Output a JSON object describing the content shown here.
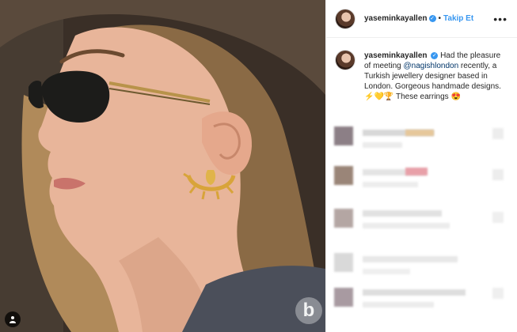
{
  "post": {
    "username": "yaseminkayallen",
    "follow_label": "Takip Et",
    "more_label": "•••",
    "caption_prefix": "Had the pleasure of meeting ",
    "caption_mention": "@nagishlondon",
    "caption_suffix": " recently, a Turkish jewellery designer based in London. Gorgeous handmade designs.",
    "caption_emojis": "⚡💛🏆",
    "caption_end": "These earrings 😍"
  },
  "watermark": {
    "text": "b"
  },
  "icons": {
    "verified": "verified-badge-icon",
    "user_tag": "user-tag-icon",
    "more": "more-options-icon"
  },
  "colors": {
    "link": "#3897f0",
    "mention": "#003569",
    "text": "#262626"
  }
}
